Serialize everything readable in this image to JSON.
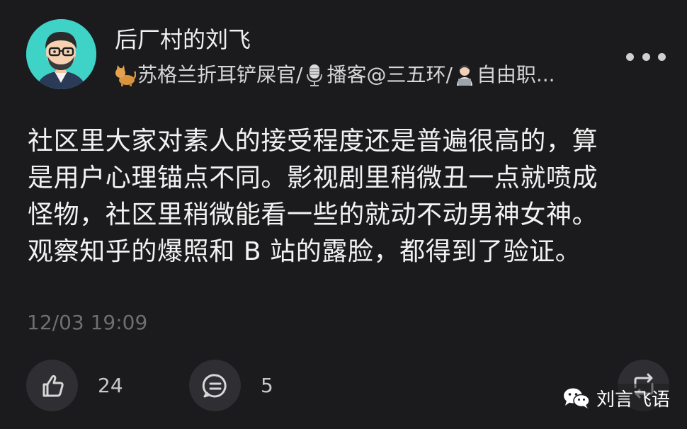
{
  "post": {
    "author": {
      "name": "后厂村的刘飞",
      "avatar": "avatar",
      "bio_segments": [
        {
          "emoji": "cat-emoji",
          "text": "苏格兰折耳铲屎官/"
        },
        {
          "emoji": "microphone-emoji",
          "text": "播客@三五环/"
        },
        {
          "emoji": "technologist-emoji",
          "text": "自由职..."
        }
      ]
    },
    "body_lines": [
      "社区里大家对素人的接受程度还是普遍很高的，算",
      "是用户心理锚点不同。影视剧里稍微丑一点就喷成",
      "怪物，社区里稍微能看一些的就动不动男神女神。",
      "观察知乎的爆照和 B 站的露脸，都得到了验证。"
    ],
    "timestamp": "12/03 19:09",
    "actions": {
      "like_count": "24",
      "comment_count": "5"
    }
  },
  "watermark": {
    "text": "刘言飞语",
    "icon": "wechat-icon"
  },
  "colors": {
    "background": "#1b1b1d",
    "avatar_bg": "#3fd2c6",
    "button_bg": "#2f2f33",
    "timestamp": "#6f6f72"
  }
}
